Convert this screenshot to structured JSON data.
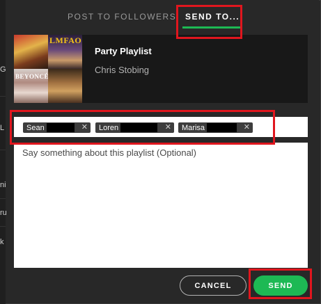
{
  "tabs": [
    {
      "label": "POST TO FOLLOWERS",
      "active": false
    },
    {
      "label": "SEND TO...",
      "active": true
    }
  ],
  "playlist": {
    "title": "Party Playlist",
    "owner": "Chris Stobing",
    "cover_text_1": "LMFAO",
    "cover_text_2": "BEYONCÉ"
  },
  "recipients": [
    {
      "name": "Sean",
      "remove_icon": "close-icon"
    },
    {
      "name": "Loren",
      "remove_icon": "close-icon"
    },
    {
      "name": "Marisa",
      "remove_icon": "close-icon"
    }
  ],
  "message": {
    "placeholder": "Say something about this playlist (Optional)",
    "value": ""
  },
  "buttons": {
    "cancel": "CANCEL",
    "send": "SEND"
  },
  "background_letters": [
    "G",
    "L",
    "ni",
    "ru",
    "k"
  ],
  "colors": {
    "accent": "#1db954",
    "annotation": "#e0161e",
    "dialog_bg": "#282828"
  }
}
